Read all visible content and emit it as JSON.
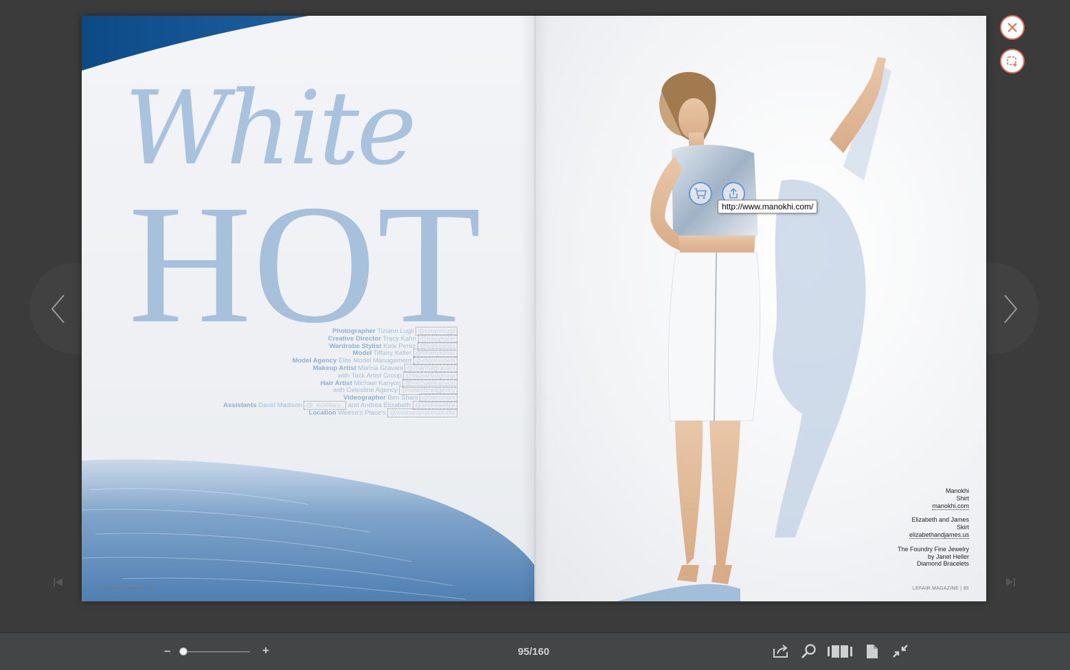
{
  "magazine": {
    "title_script": "White",
    "title_big": "HOT",
    "credits": [
      {
        "role": "Photographer",
        "name": "Tiziano Lugli",
        "handle": "@tizianolugli"
      },
      {
        "role": "Creative Director",
        "name": "Tracy Kahn",
        "handle": "@tracykahn"
      },
      {
        "role": "Wardrobe Stylist",
        "name": "Kate Perez",
        "handle": "@kateperez"
      },
      {
        "role": "Model",
        "name": "Tiffany Keller",
        "handle": "@tiffanykeller"
      },
      {
        "role": "Model Agency",
        "name": "Elite Model Management",
        "handle": "@elitemodels"
      },
      {
        "role": "Makeup Artist",
        "name": "Marina Gravani",
        "handle": "@marinagravani"
      },
      {
        "role": "",
        "name": "with Tack Artist Group",
        "handle": "@tackartistgroup"
      },
      {
        "role": "Hair Artist",
        "name": "Michael Kanyon",
        "handle": "@michaelkanyon"
      },
      {
        "role": "",
        "name": "with Celestine Agency",
        "handle": "@celestineagency"
      },
      {
        "role": "Videographer",
        "name": "Ben Shani",
        "handle": "@benshani"
      },
      {
        "role": "Assistants",
        "name": "David Madison",
        "handle": "@_auxiliary_",
        "extra": "and Andrea Elizabeth",
        "handle2": "@andreaeliza"
      },
      {
        "role": "Location",
        "name": "Weese's Place's",
        "handle": "@weesesplacesstudio"
      }
    ],
    "folio_left": "94  |  LEFAIR MAGAZINE",
    "folio_right": "LEFAIR MAGAZINE  |  95",
    "captions": [
      {
        "brand": "Manokhi",
        "item": "Shirt",
        "link": "manokhi.com"
      },
      {
        "brand": "Elizabeth and James",
        "item": "Skirt",
        "link": "elizabethandjames.us"
      },
      {
        "brand": "The Foundry Fine Jewelry",
        "item": "by Janet Heller",
        "link": "Diamond Bracelets"
      }
    ],
    "tooltip": "http://www.manokhi.com/"
  },
  "toolbar": {
    "zoom_minus": "–",
    "zoom_plus": "+",
    "zoom_level": 0.02,
    "page_counter": "95/160"
  },
  "icons": {
    "close": "close-icon",
    "add_bookmark": "add-bookmark-icon",
    "shop": "cart-icon",
    "share": "share-icon",
    "prev": "chevron-left-icon",
    "next": "chevron-right-icon",
    "first": "first-page-icon",
    "last": "last-page-icon",
    "toolbar_share": "share-icon",
    "search": "search-icon",
    "thumbnails": "thumbnails-icon",
    "single_page": "single-page-icon",
    "exit_fullscreen": "exit-fullscreen-icon"
  },
  "colors": {
    "accent_red": "#e46a5c",
    "title_blue": "#a7c0dc",
    "hotspot_blue": "#6b95cc"
  }
}
